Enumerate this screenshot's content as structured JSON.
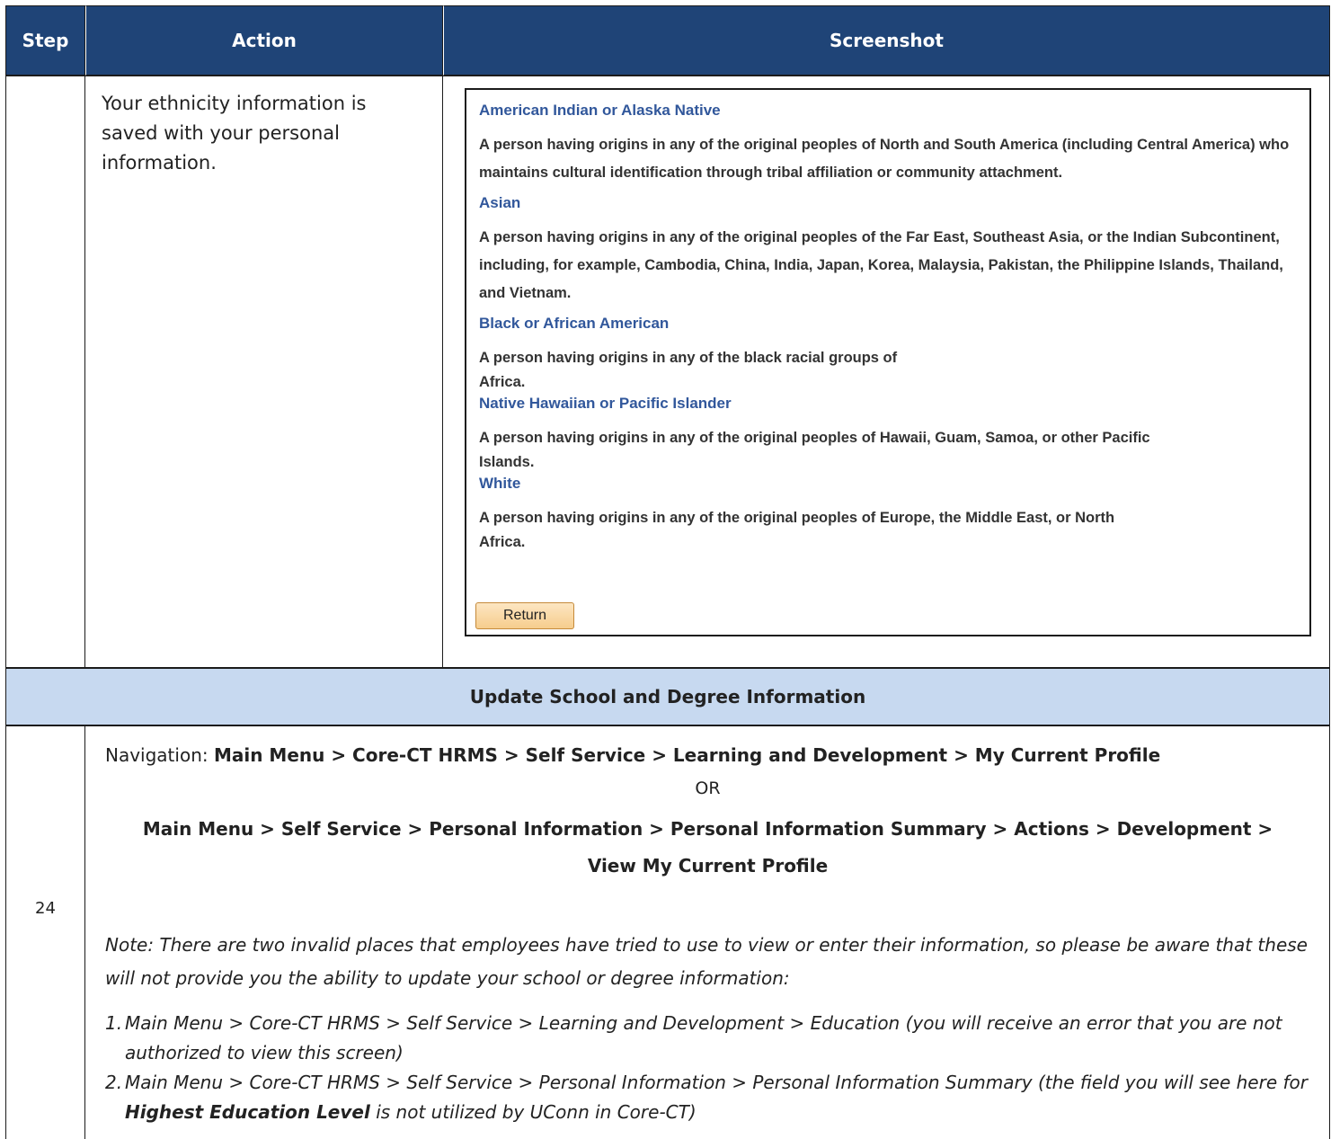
{
  "table": {
    "headers": {
      "step": "Step",
      "action": "Action",
      "screenshot": "Screenshot"
    }
  },
  "row1": {
    "action_text": "Your ethnicity information is saved with your personal information.",
    "screenshot": {
      "entries": [
        {
          "heading": "American Indian or Alaska Native",
          "description": "A person having origins in any of the original peoples of North and South America (including Central America) who maintains cultural identification through tribal affiliation or community attachment."
        },
        {
          "heading": "Asian",
          "description": "A person having origins in any of the original peoples of the Far East, Southeast Asia, or the Indian Subcontinent, including, for example, Cambodia, China, India, Japan, Korea, Malaysia, Pakistan, the Philippine Islands, Thailand, and Vietnam."
        },
        {
          "heading": "Black or African American",
          "description_lines": [
            "A person having origins in any of the black racial groups of",
            "Africa."
          ]
        },
        {
          "heading": "Native Hawaiian or Pacific Islander",
          "description_lines": [
            "A person having origins in any of the original peoples of Hawaii, Guam, Samoa, or other Pacific",
            "Islands."
          ]
        },
        {
          "heading": "White",
          "description_lines": [
            "A person having origins in any of the original peoples of Europe, the Middle East, or North",
            "Africa."
          ]
        }
      ],
      "return_button": "Return"
    }
  },
  "section": {
    "title": "Update School and Degree Information"
  },
  "row2": {
    "step": "24",
    "nav_label": "Navigation: ",
    "nav_path": "Main Menu > Core-CT HRMS > Self Service > Learning and Development > My Current Profile",
    "or": "OR",
    "alt_path_line1": "Main Menu > Self Service > Personal Information > Personal Information Summary > Actions > Development >",
    "alt_path_line2": "View My Current Profile",
    "note": "Note: There are two invalid places that employees have tried to use to view or enter their information, so please be aware that these will not provide you the ability to update your school or degree information:",
    "items": [
      {
        "num": "1.",
        "text": "Main Menu > Core-CT HRMS > Self Service > Learning and Development > Education (you will receive an error that you are not authorized to view this screen)"
      },
      {
        "num": "2.",
        "text_before": "Main Menu > Core-CT HRMS > Self Service > Personal Information > Personal Information Summary (the field you will see here for ",
        "bold": "Highest Education Level",
        "text_after": " is not utilized by UConn in Core-CT)"
      }
    ]
  }
}
